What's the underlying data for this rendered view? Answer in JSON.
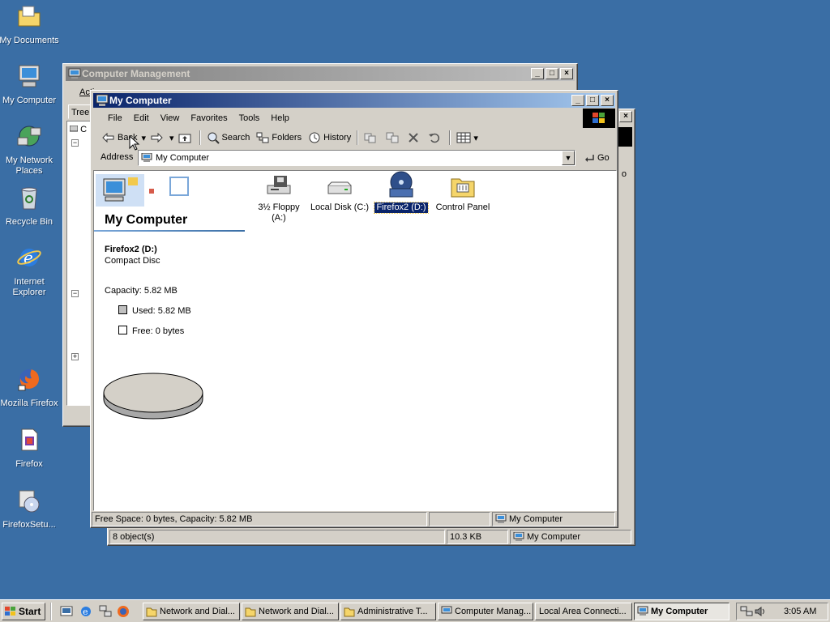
{
  "desktop": {
    "icons": [
      {
        "label": "My Documents",
        "icon": "folder-documents-icon"
      },
      {
        "label": "My Computer",
        "icon": "computer-icon"
      },
      {
        "label": "My Network Places",
        "icon": "network-places-icon"
      },
      {
        "label": "Recycle Bin",
        "icon": "recycle-bin-icon"
      },
      {
        "label": "Internet Explorer",
        "icon": "internet-explorer-icon"
      },
      {
        "label": "Mozilla Firefox",
        "icon": "firefox-icon"
      },
      {
        "label": "Firefox",
        "icon": "installer-icon"
      },
      {
        "label": "FirefoxSetu...",
        "icon": "setup-icon"
      }
    ]
  },
  "computer_management": {
    "title": "Computer Management",
    "toolbar_partial": "Action",
    "tree_tab": "Tree",
    "tree_fragment": "C",
    "right_fragment": "o",
    "status": {
      "objects": "8 object(s)",
      "size": "10.3 KB",
      "zone": "My Computer"
    }
  },
  "my_computer": {
    "title": "My Computer",
    "menu": [
      "File",
      "Edit",
      "View",
      "Favorites",
      "Tools",
      "Help"
    ],
    "toolbar": {
      "back": "Back",
      "search": "Search",
      "folders": "Folders",
      "history": "History"
    },
    "address_label": "Address",
    "address_value": "My Computer",
    "go": "Go",
    "panel": {
      "heading": "My Computer",
      "item_name": "Firefox2 (D:)",
      "item_type": "Compact Disc",
      "capacity": "Capacity: 5.82 MB",
      "used": "Used: 5.82 MB",
      "free": "Free: 0 bytes",
      "used_fraction": 1.0
    },
    "items": [
      {
        "label": "3½ Floppy (A:)",
        "icon": "floppy-drive-icon",
        "selected": false
      },
      {
        "label": "Local Disk (C:)",
        "icon": "hard-disk-icon",
        "selected": false
      },
      {
        "label": "Firefox2 (D:)",
        "icon": "cd-drive-icon",
        "selected": true
      },
      {
        "label": "Control Panel",
        "icon": "control-panel-icon",
        "selected": false
      }
    ],
    "status": {
      "info": "Free Space: 0 bytes, Capacity: 5.82 MB",
      "zone": "My Computer"
    }
  },
  "taskbar": {
    "start": "Start",
    "tasks": [
      "Network and Dial...",
      "Network and Dial...",
      "Administrative T...",
      "Computer Manag...",
      "Local Area Connecti...",
      "My Computer"
    ],
    "clock": "3:05 AM"
  },
  "colors": {
    "desktop": "#3a6ea5",
    "title_active": "#0a246a",
    "selection": "#0a246a",
    "window": "#d4d0c8"
  }
}
